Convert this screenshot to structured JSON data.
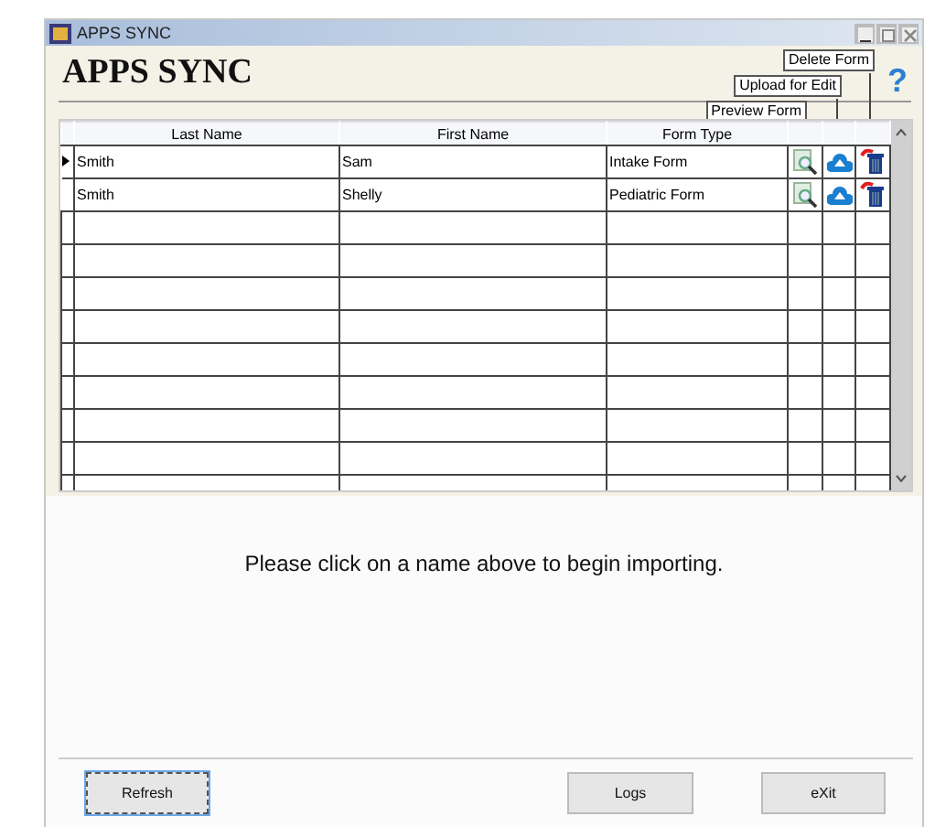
{
  "window": {
    "title": "APPS SYNC"
  },
  "header": {
    "title": "APPS SYNC",
    "help": "?"
  },
  "callouts": [
    "Delete Form",
    "Upload for Edit",
    "Preview Form"
  ],
  "table": {
    "columns": [
      "Last Name",
      "First Name",
      "Form Type"
    ],
    "rows": [
      {
        "last_name": "Smith",
        "first_name": "Sam",
        "form_type": "Intake Form",
        "selected": true
      },
      {
        "last_name": "Smith",
        "first_name": "Shelly",
        "form_type": "Pediatric Form",
        "selected": false
      }
    ],
    "kind": "grid"
  },
  "message": "Please click on a name above to begin importing.",
  "buttons": [
    {
      "label": "Refresh",
      "focused": true
    },
    {
      "label": "Logs",
      "focused": false
    },
    {
      "label": "eXit",
      "focused": false
    }
  ]
}
